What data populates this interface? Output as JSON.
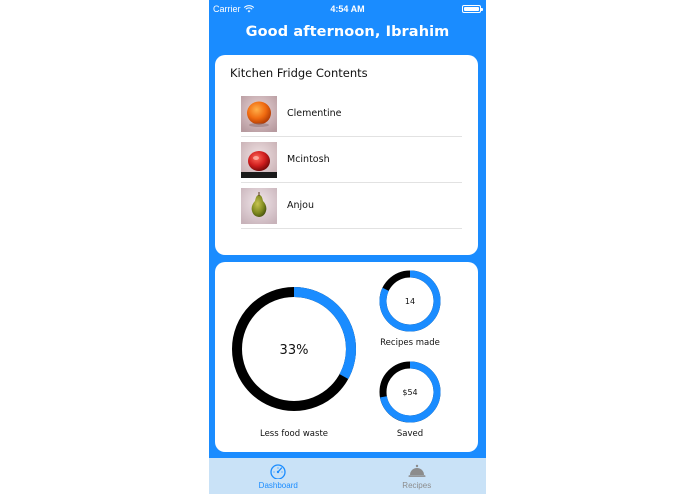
{
  "status_bar": {
    "carrier": "Carrier",
    "time": "4:54 AM",
    "wifi_icon": "wifi-icon",
    "battery_icon": "battery-icon"
  },
  "header": {
    "greeting": "Good afternoon, Ibrahim"
  },
  "fridge": {
    "title": "Kitchen Fridge Contents",
    "items": [
      {
        "name": "Clementine",
        "image": "clementine-photo"
      },
      {
        "name": "Mcintosh",
        "image": "mcintosh-apple-photo"
      },
      {
        "name": "Anjou",
        "image": "anjou-pear-photo"
      }
    ]
  },
  "stats": {
    "food_waste": {
      "value": "33%",
      "label": "Less food waste",
      "fraction": 0.33
    },
    "recipes_made": {
      "value": "14",
      "label": "Recipes made",
      "fraction": 0.82
    },
    "saved": {
      "value": "$54",
      "label": "Saved",
      "fraction": 0.72
    }
  },
  "tab_bar": {
    "tabs": [
      {
        "label": "Dashboard",
        "icon": "speedometer-icon",
        "active": true
      },
      {
        "label": "Recipes",
        "icon": "cloche-icon",
        "active": false
      }
    ]
  },
  "colors": {
    "primary": "#1a8cff",
    "ring_track": "#000000",
    "tab_bar": "#c9e2f7",
    "inactive_tab": "#8c8c8c"
  }
}
